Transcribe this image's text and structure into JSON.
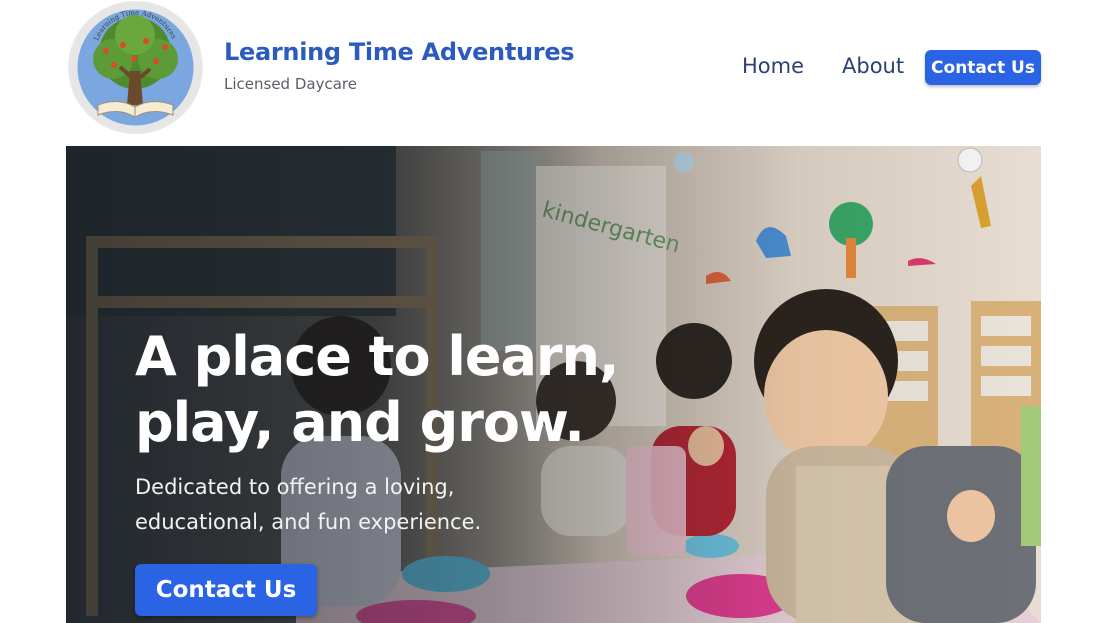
{
  "header": {
    "logo": {
      "icon": "tree-book-logo-icon",
      "arc_text": "Learning Time Adventures"
    },
    "brand_title": "Learning Time Adventures",
    "brand_subtitle": "Licensed Daycare",
    "nav": {
      "home": "Home",
      "about": "About",
      "contact": "Contact Us"
    }
  },
  "hero": {
    "heading_line1": "A place to learn,",
    "heading_line2": "play, and grow.",
    "text_line1": "Dedicated to offering a loving,",
    "text_line2": "educational, and fun experience.",
    "cta": "Contact Us",
    "wall_text": "kindergarten",
    "background": "classroom-photo-children"
  },
  "colors": {
    "brand_blue": "#2c5bbf",
    "button_blue": "#2a63e4",
    "nav_text": "#2b3f78",
    "subtitle_gray": "#5a5e66"
  }
}
